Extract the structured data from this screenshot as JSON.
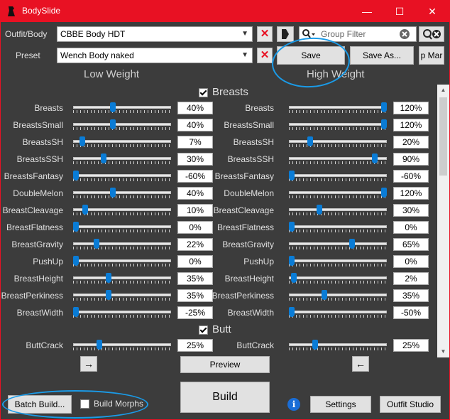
{
  "window": {
    "title": "BodySlide",
    "minimize": "—",
    "maximize": "☐",
    "close": "✕"
  },
  "outfit": {
    "label": "Outfit/Body",
    "value": "CBBE Body HDT"
  },
  "preset": {
    "label": "Preset",
    "value": "Wench Body naked"
  },
  "search": {
    "placeholder": "Group Filter"
  },
  "buttons": {
    "save": "Save",
    "save_as": "Save As...",
    "map": "p Mar",
    "preview": "Preview",
    "build": "Build",
    "batch_build": "Batch Build...",
    "settings": "Settings",
    "outfit_studio": "Outfit Studio",
    "arrow_right": "→",
    "arrow_left": "←",
    "build_morphs": "Build Morphs"
  },
  "columns": {
    "low": "Low Weight",
    "high": "High Weight"
  },
  "sections": [
    {
      "name": "Breasts",
      "checked": true,
      "sliders": [
        {
          "label": "Breasts",
          "low": "40%",
          "high": "120%",
          "low_pos": 0.4,
          "high_pos": 1.0
        },
        {
          "label": "BreastsSmall",
          "low": "40%",
          "high": "120%",
          "low_pos": 0.4,
          "high_pos": 1.0
        },
        {
          "label": "BreastsSH",
          "low": "7%",
          "high": "20%",
          "low_pos": 0.07,
          "high_pos": 0.2
        },
        {
          "label": "BreastsSSH",
          "low": "30%",
          "high": "90%",
          "low_pos": 0.3,
          "high_pos": 0.9
        },
        {
          "label": "BreastsFantasy",
          "low": "-60%",
          "high": "-60%",
          "low_pos": 0.0,
          "high_pos": 0.0
        },
        {
          "label": "DoubleMelon",
          "low": "40%",
          "high": "120%",
          "low_pos": 0.4,
          "high_pos": 1.0
        },
        {
          "label": "BreastCleavage",
          "low": "10%",
          "high": "30%",
          "low_pos": 0.1,
          "high_pos": 0.3
        },
        {
          "label": "BreastFlatness",
          "low": "0%",
          "high": "0%",
          "low_pos": 0.0,
          "high_pos": 0.0
        },
        {
          "label": "BreastGravity",
          "low": "22%",
          "high": "65%",
          "low_pos": 0.22,
          "high_pos": 0.65
        },
        {
          "label": "PushUp",
          "low": "0%",
          "high": "0%",
          "low_pos": 0.0,
          "high_pos": 0.0
        },
        {
          "label": "BreastHeight",
          "low": "35%",
          "high": "2%",
          "low_pos": 0.35,
          "high_pos": 0.02
        },
        {
          "label": "BreastPerkiness",
          "low": "35%",
          "high": "35%",
          "low_pos": 0.35,
          "high_pos": 0.35
        },
        {
          "label": "BreastWidth",
          "low": "-25%",
          "high": "-50%",
          "low_pos": 0.0,
          "high_pos": 0.0
        }
      ]
    },
    {
      "name": "Butt",
      "checked": true,
      "sliders": [
        {
          "label": "ButtCrack",
          "low": "25%",
          "high": "25%",
          "low_pos": 0.25,
          "high_pos": 0.25
        }
      ]
    }
  ],
  "colors": {
    "accent": "#e81123",
    "background": "#3c3c3c",
    "slider_thumb": "#0a7cd6",
    "annotation": "#1a9be8"
  }
}
